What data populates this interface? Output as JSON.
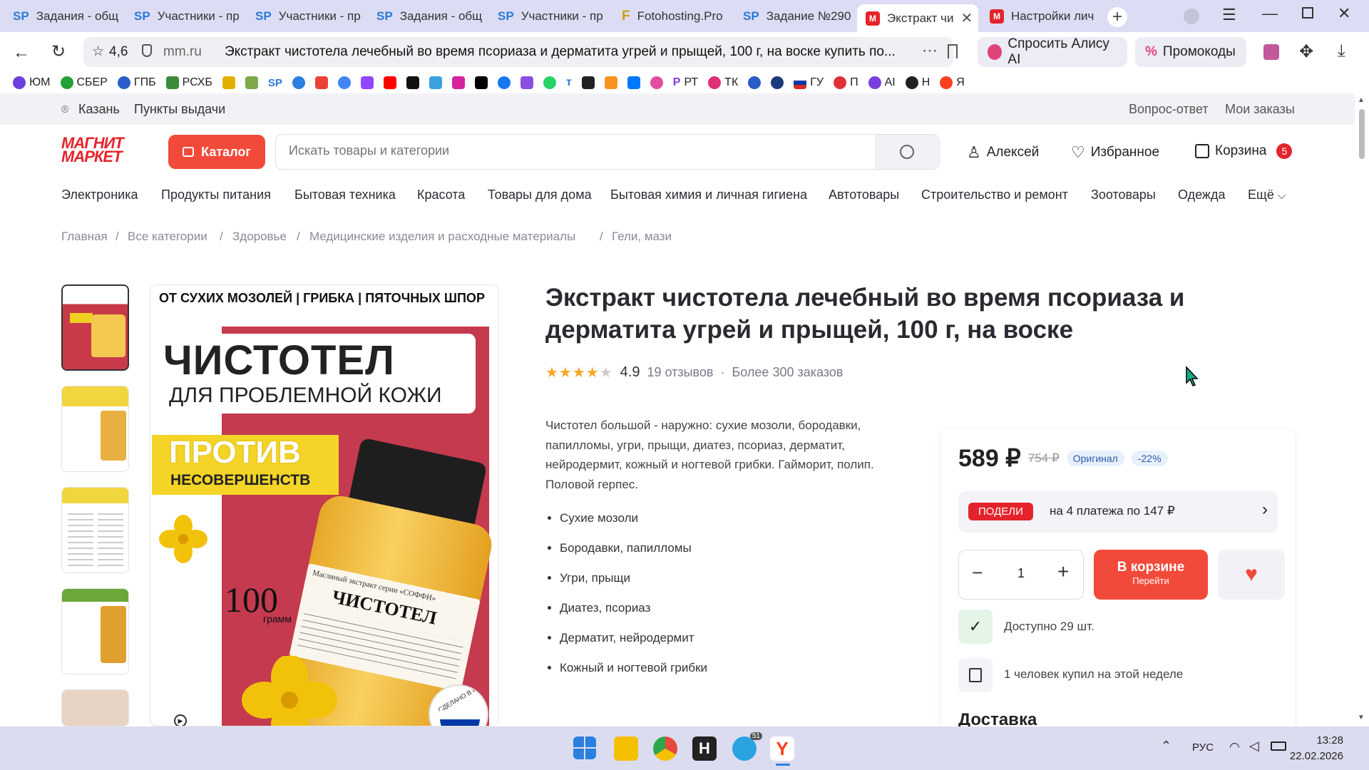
{
  "tabs": [
    {
      "label": "Задания - общ",
      "icon": "sp"
    },
    {
      "label": "Участники - пр",
      "icon": "sp"
    },
    {
      "label": "Участники - пр",
      "icon": "sp"
    },
    {
      "label": "Задания - общ",
      "icon": "sp"
    },
    {
      "label": "Участники - пр",
      "icon": "sp"
    },
    {
      "label": "Fotohosting.Pro",
      "icon": "fotohosting"
    },
    {
      "label": "Задание №290",
      "icon": "sp"
    },
    {
      "label": "Экстракт чи",
      "icon": "magnit",
      "active": true
    },
    {
      "label": "Настройки лич",
      "icon": "magnit"
    }
  ],
  "address": {
    "rating": "4,6",
    "domain": "mm.ru",
    "title": "Экстракт чистотела лечебный во время псориаза и дерматита угрей и прыщей, 100 г, на воске купить по...",
    "alice": "Спросить Алису AI",
    "promo": "Промокоды"
  },
  "bookmarks": [
    "ЮМ",
    "СБЕР",
    "ГПБ",
    "РСХБ",
    "",
    "",
    "",
    "",
    "",
    "",
    "",
    "",
    "",
    "",
    "",
    "",
    "",
    "",
    "",
    "",
    "",
    "",
    "",
    "РТ",
    "ТК",
    "",
    "",
    "ГУ",
    "П",
    "AI",
    "Н",
    "Я"
  ],
  "site": {
    "city": "Казань",
    "pickup": "Пункты выдачи",
    "faq": "Вопрос-ответ",
    "orders": "Мои заказы",
    "logo_line1": "МАГНИТ",
    "logo_line2": "МАРКЕТ",
    "catalog": "Каталог",
    "search_placeholder": "Искать товары и категории",
    "user": "Алексей",
    "favorites": "Избранное",
    "cart": "Корзина",
    "cart_count": "5"
  },
  "categories": [
    "Электроника",
    "Продукты питания",
    "Бытовая техника",
    "Красота",
    "Товары для дома",
    "Бытовая химия и личная гигиена",
    "Автотовары",
    "Строительство и ремонт",
    "Зоотовары",
    "Одежда",
    "Ещё"
  ],
  "breadcrumbs": [
    "Главная",
    "Все категории",
    "Здоровье",
    "Медицинские изделия и расходные материалы",
    "Гели, мази"
  ],
  "product": {
    "title": "Экстракт чистотела лечебный во время псориаза и дерматита угрей и прыщей, 100 г, на воске",
    "stars": 4,
    "rating": "4.9",
    "reviews": "19 отзывов",
    "orders": "Более 300 заказов",
    "description": "Чистотел большой - наружно: сухие мозоли, бородавки, папилломы, угри, прыщи, диатез, псориаз, дерматит, нейродермит, кожный и ногтевой грибки. Гайморит, полип. Половой герпес.",
    "features": [
      "Сухие мозоли",
      "Бородавки, папилломы",
      "Угри, прыщи",
      "Диатез, псориаз",
      "Дерматит, нейродермит",
      "Кожный и ногтевой грибки"
    ],
    "image_text": {
      "top": "ОТ СУХИХ МОЗОЛЕЙ | ГРИБКА | ПЯТОЧНЫХ ШПОР",
      "big": "ЧИСТОТЕЛ",
      "sub": "ДЛЯ ПРОБЛЕМНОЙ КОЖИ",
      "against1": "ПРОТИВ",
      "against2": "НЕСОВЕРШЕНСТВ",
      "weight": "100",
      "weight_unit": "грамм",
      "jar_label": "ЧИСТОТЕЛ",
      "jar_top": "Масляный экстракт серии «СОФФИ»",
      "made_in": "СДЕЛАНО В РОССИИ"
    }
  },
  "buy": {
    "price": "589 ₽",
    "old_price": "754 ₽",
    "original": "Оригинал",
    "discount": "-22%",
    "split_logo": "ПОДЕЛИ",
    "split_text": "на 4 платежа по 147 ₽",
    "qty": "1",
    "in_cart": "В корзине",
    "goto": "Перейти",
    "available": "Доступно 29 шт.",
    "bought": "1 человек купил на этой неделе",
    "delivery": "Доставка"
  },
  "taskbar": {
    "lang": "РУС",
    "time": "13:28",
    "date": "22.02.2026",
    "telegram_badge": "51"
  },
  "colors": {
    "brand": "#e5232c",
    "catalog": "#f24a3a",
    "star": "#f5a623",
    "accent_blue": "#2a7bd6"
  }
}
